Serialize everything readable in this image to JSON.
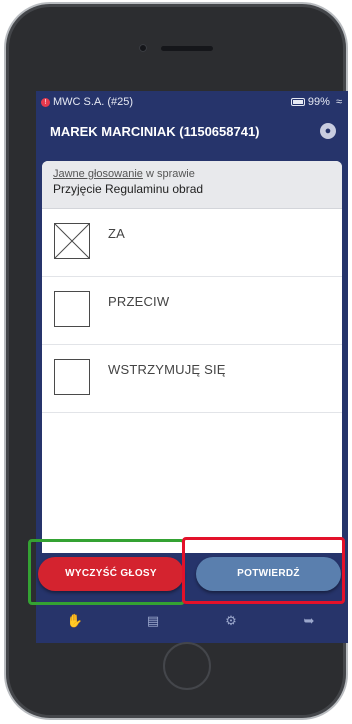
{
  "status_bar": {
    "error_icon": "error-dot-icon",
    "company": "MWC S.A. (#25)",
    "battery": "99%",
    "battery_icon": "battery-icon",
    "wifi_icon": "wifi-icon"
  },
  "header": {
    "user": "MAREK MARCINIAK (1150658741)",
    "globe_icon": "globe-icon"
  },
  "vote": {
    "type_link": "Jawne głosowanie",
    "type_rest": " w sprawie",
    "subject": "Przyjęcie Regulaminu obrad"
  },
  "options": [
    {
      "label": "ZA",
      "checked": true
    },
    {
      "label": "PRZECIW",
      "checked": false
    },
    {
      "label": "WSTRZYMUJĘ SIĘ",
      "checked": false
    }
  ],
  "actions": {
    "clear_label": "WYCZYŚĆ GŁOSY",
    "confirm_label": "POTWIERDŹ"
  },
  "nav": [
    {
      "icon": "hand-icon"
    },
    {
      "icon": "chat-icon"
    },
    {
      "icon": "gear-icon"
    },
    {
      "icon": "logout-icon"
    }
  ],
  "colors": {
    "app_background": "#26346b",
    "clear_button": "#d4232f",
    "confirm_button": "#5a7fae",
    "highlight_green": "#34a233",
    "highlight_red": "#e3112a"
  }
}
